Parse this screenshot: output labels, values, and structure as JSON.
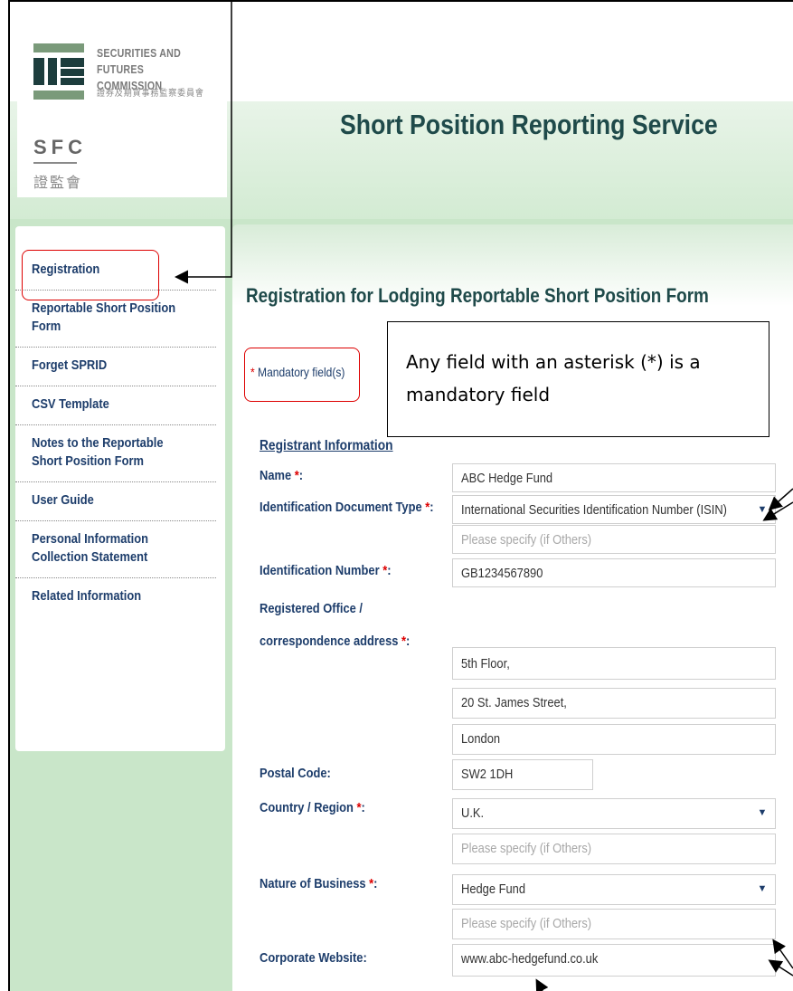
{
  "logo": {
    "name_en_line1": "SECURITIES AND",
    "name_en_line2": "FUTURES COMMISSION",
    "name_zh": "證券及期貨事務監察委員會",
    "abbr": "SFC",
    "abbr_zh": "證監會"
  },
  "site_title": "Short Position Reporting Service",
  "sidebar": {
    "items": [
      {
        "label": "Registration"
      },
      {
        "label": "Reportable Short Position\nForm"
      },
      {
        "label": "Forget SPRID"
      },
      {
        "label": "CSV Template"
      },
      {
        "label": "Notes to the Reportable\nShort Position Form"
      },
      {
        "label": "User Guide"
      },
      {
        "label": "Personal Information\nCollection Statement"
      },
      {
        "label": "Related Information"
      }
    ]
  },
  "main": {
    "title": "Registration for Lodging Reportable Short Position Form",
    "mandatory_note": "Mandatory field(s)",
    "mandatory_star": "*",
    "section_heading": "Registrant Information"
  },
  "callout": {
    "text": "Any field with an asterisk (*) is a mandatory field"
  },
  "form": {
    "name_label": "Name",
    "name_value": "ABC Hedge Fund",
    "id_type_label": "Identification Document Type",
    "id_type_value": "International Securities Identification Number (ISIN)",
    "id_type_other_placeholder": "Please specify (if Others)",
    "id_number_label": "Identification Number",
    "id_number_value": "GB1234567890",
    "address_label_line1": "Registered Office /",
    "address_label_line2": "correspondence address",
    "address_line1": "5th Floor,",
    "address_line2": "20 St. James Street,",
    "address_line3": "London",
    "postal_label": "Postal Code:",
    "postal_value": "SW2 1DH",
    "country_label": "Country / Region",
    "country_value": "U.K.",
    "country_other_placeholder": "Please specify (if Others)",
    "business_label": "Nature of Business",
    "business_value": "Hedge Fund",
    "business_other_placeholder": "Please specify (if Others)",
    "website_label": "Corporate Website:",
    "website_value": "www.abc-hedgefund.co.uk",
    "star": "*",
    "colon": ":"
  },
  "colors": {
    "page_green": "#c9e6c9",
    "title_dark": "#1f4a4a",
    "link_navy": "#1d3d6b",
    "required_red": "#dd0000"
  }
}
